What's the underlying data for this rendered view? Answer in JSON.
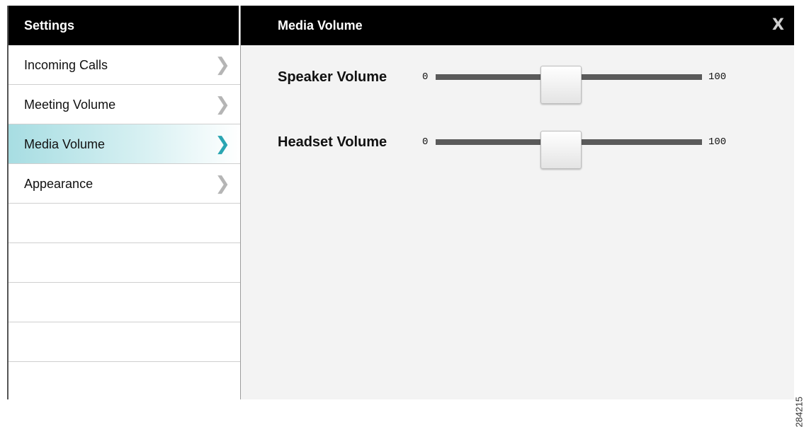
{
  "sidebar": {
    "title": "Settings",
    "items": [
      {
        "label": "Incoming Calls",
        "selected": false
      },
      {
        "label": "Meeting Volume",
        "selected": false
      },
      {
        "label": "Media Volume",
        "selected": true
      },
      {
        "label": "Appearance",
        "selected": false
      }
    ],
    "chevron_icon": "chevron-right-icon"
  },
  "main": {
    "title": "Media Volume",
    "close_icon": "close-icon",
    "close_glyph": "X",
    "sliders": [
      {
        "label": "Speaker Volume",
        "min": "0",
        "max": "100",
        "value": 47
      },
      {
        "label": "Headset Volume",
        "min": "0",
        "max": "100",
        "value": 47
      }
    ]
  },
  "watermark": "284215",
  "colors": {
    "header_bg": "#000000",
    "accent": "#2aa5b2",
    "selected_bg": "#a7dde2"
  }
}
